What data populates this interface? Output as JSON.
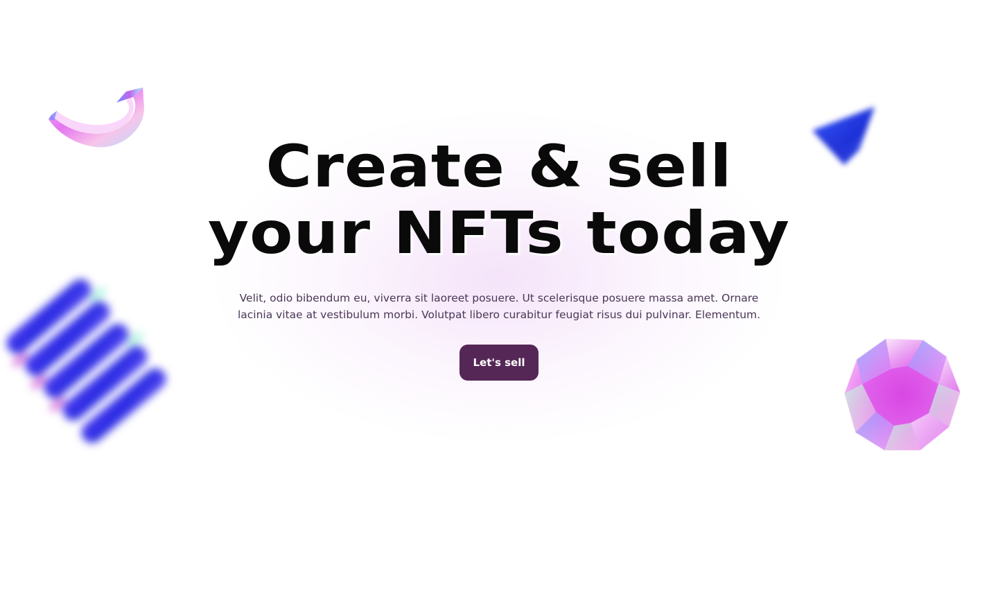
{
  "hero": {
    "headline_line_1": "Create & sell",
    "headline_line_2": "your NFTs today",
    "subtitle": "Velit, odio bibendum eu, viverra sit laoreet posuere. Ut scelerisque posuere massa amet. Ornare lacinia vitae at vestibulum morbi. Volutpat libero curabitur feugiat risus dui pulvinar. Elementum.",
    "cta_label": "Let's sell"
  },
  "decorations": {
    "top_left": "curved-glass-arrow-icon",
    "top_right": "blue-pyramid-icon",
    "left": "holographic-coil-icon",
    "right": "holographic-gem-icon"
  },
  "colors": {
    "cta_background": "#552756",
    "headline": "#0a0a0a",
    "subtitle": "#4a3656",
    "accent_pink": "#e36ef0",
    "accent_blue": "#2a3be8"
  }
}
